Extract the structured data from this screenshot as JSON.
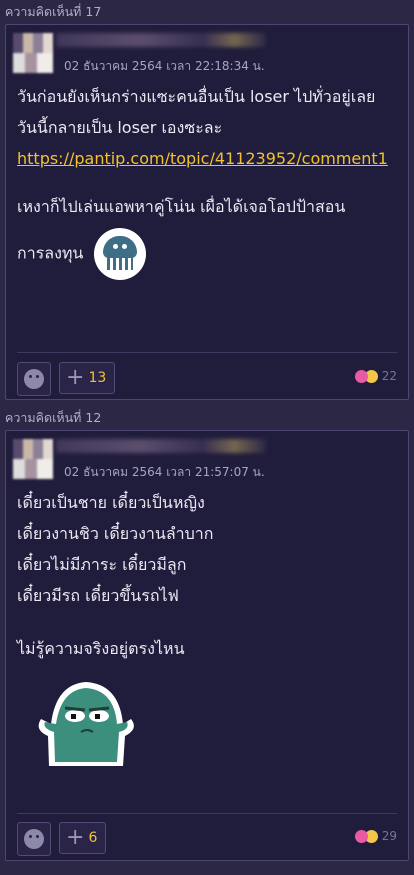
{
  "comments": [
    {
      "header": "ความคิดเห็นที่ 17",
      "timestamp": "02 ธันวาคม 2564 เวลา 22:18:34 น.",
      "lines": [
        "วันก่อนยังเห็นกร่างแซะคนอื่นเป็น loser ไปทั่วอยู่เลย  วันนี้กลายเป็น loser เองซะละ"
      ],
      "link": "https://pantip.com/topic/41123952/comment1",
      "lines2": [
        "เหงาก็ไปเล่นแอพหาคู่โน่น เผื่อได้เจอโอปป้าสอน",
        "การลงทุน"
      ],
      "plus_count": "13",
      "reaction_count": "22"
    },
    {
      "header": "ความคิดเห็นที่ 12",
      "timestamp": "02 ธันวาคม 2564 เวลา 21:57:07 น.",
      "lines": [
        "เดี๋ยวเป็นชาย เดี๋ยวเป็นหญิง",
        "เดี๋ยวงานชิว เดี๋ยวงานลำบาก",
        "เดี๋ยวไม่มีภาระ เดี๋ยวมีลูก",
        "เดี๋ยวมีรถ เดี๋ยวขึ้นรถไฟ",
        "",
        "ไม่รู้ความจริงอยู่ตรงไหน"
      ],
      "plus_count": "6",
      "reaction_count": "29"
    }
  ],
  "icons": {
    "emotion": "smiley-icon",
    "plus": "plus-icon",
    "heart": "heart-reaction-icon",
    "laugh": "laugh-reaction-icon"
  },
  "colors": {
    "background": "#2b2745",
    "card": "#201c3b",
    "accent": "#f2c230",
    "heart": "#e85aa5"
  }
}
